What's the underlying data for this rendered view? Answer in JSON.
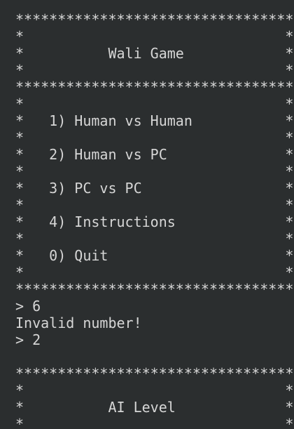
{
  "terminal": {
    "lines": [
      "*********************************",
      "*                               *",
      "*          Wali Game            *",
      "*                               *",
      "*********************************",
      "*                               *",
      "*   1) Human vs Human           *",
      "*                               *",
      "*   2) Human vs PC              *",
      "*                               *",
      "*   3) PC vs PC                 *",
      "*                               *",
      "*   4) Instructions             *",
      "*                               *",
      "*   0) Quit                     *",
      "*                               *",
      "*********************************",
      "> 6",
      "Invalid number!",
      "> 2",
      "",
      "*********************************",
      "*                               *",
      "*          AI Level             *",
      "*                               *"
    ]
  }
}
